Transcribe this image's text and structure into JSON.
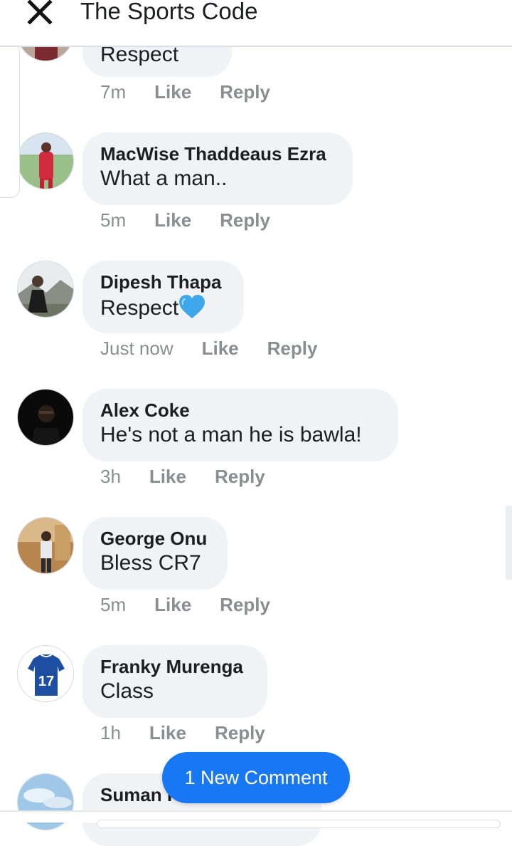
{
  "header": {
    "title": "The Sports Code",
    "close_icon": "close-icon"
  },
  "comments": [
    {
      "author": "",
      "text": "Respect",
      "time": "7m",
      "like": "Like",
      "reply": "Reply"
    },
    {
      "author": "MacWise Thaddeaus Ezra",
      "text": "What a man..",
      "time": "5m",
      "like": "Like",
      "reply": "Reply"
    },
    {
      "author": "Dipesh Thapa",
      "text": "Respect",
      "emoji": "blue-heart-icon",
      "time": "Just now",
      "like": "Like",
      "reply": "Reply"
    },
    {
      "author": "Alex Coke",
      "text": "He's not a man he is bawla!",
      "time": "3h",
      "like": "Like",
      "reply": "Reply"
    },
    {
      "author": "George Onu",
      "text": "Bless CR7",
      "time": "5m",
      "like": "Like",
      "reply": "Reply"
    },
    {
      "author": "Franky Murenga",
      "text": "Class",
      "time": "1h",
      "like": "Like",
      "reply": "Reply",
      "avatar_jersey_number": "17"
    },
    {
      "author": "Suman K",
      "text": ""
    }
  ],
  "new_comment_button": {
    "label": "1 New Comment"
  },
  "colors": {
    "accent": "#1877f2",
    "bubble": "#f0f2f5",
    "meta": "#8a8d91",
    "heart": "#3ea6ea"
  }
}
